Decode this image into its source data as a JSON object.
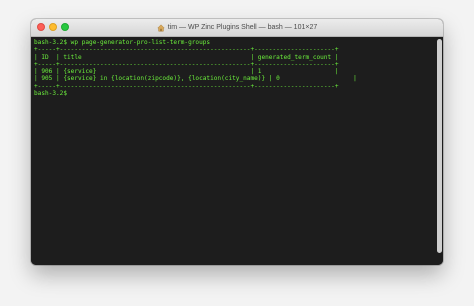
{
  "window": {
    "title": "tim — WP Zinc Plugins Shell — bash — 101×27"
  },
  "terminal": {
    "lines": [
      "bash-3.2$ wp page-generator-pro-list-term-groups",
      "+-----+----------------------------------------------------+----------------------+",
      "| ID  | title                                              | generated_term_count |",
      "+-----+----------------------------------------------------+----------------------+",
      "| 906 | {service}                                          | 1                    |",
      "| 905 | {service} in {location(zipcode)}, {location(city_name)} | 0                    |",
      "+-----+----------------------------------------------------+----------------------+",
      "bash-3.2$ "
    ]
  },
  "colors": {
    "terminal_text": "#6cf03c",
    "terminal_bg": "#1d1d1d",
    "close": "#fd5f57",
    "minimize": "#febc2e",
    "zoom": "#28c840"
  }
}
